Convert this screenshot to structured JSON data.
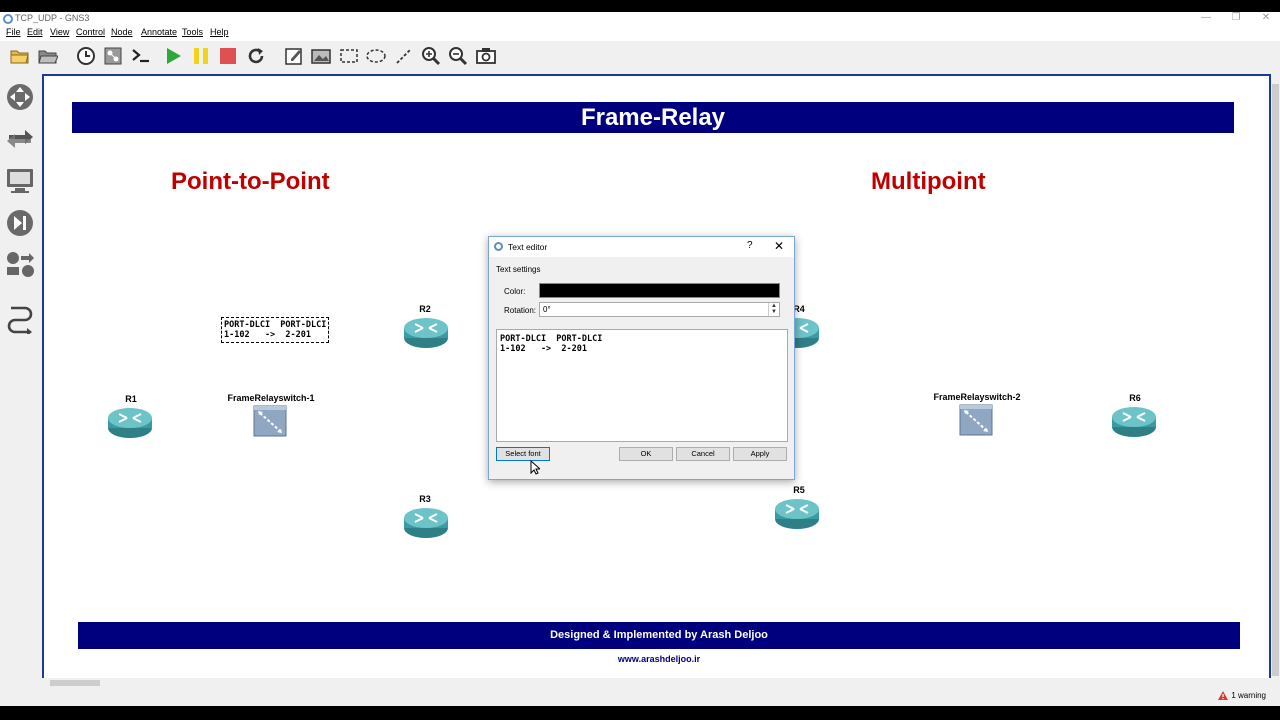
{
  "window": {
    "title": "TCP_UDP - GNS3",
    "controls": {
      "minimize": "—",
      "restore": "❐",
      "close": "✕"
    }
  },
  "menu": [
    "File",
    "Edit",
    "View",
    "Control",
    "Node",
    "Annotate",
    "Tools",
    "Help"
  ],
  "toolbar": [
    "new-project-icon",
    "open-project-icon",
    "snapshot-icon",
    "show-interface-labels-icon",
    "console-all-icon",
    "start-all-icon",
    "suspend-all-icon",
    "stop-all-icon",
    "reload-all-icon",
    "add-note-icon",
    "insert-picture-icon",
    "draw-rectangle-icon",
    "draw-ellipse-icon",
    "draw-line-icon",
    "zoom-in-icon",
    "zoom-out-icon",
    "screenshot-icon"
  ],
  "sidebar": [
    "browse-routers-icon",
    "browse-switches-icon",
    "browse-end-devices-icon",
    "browse-security-devices-icon",
    "browse-all-devices-icon",
    "add-link-icon"
  ],
  "canvas": {
    "banner_title": "Frame-Relay",
    "left_section": "Point-to-Point",
    "right_section": "Multipoint",
    "note_text": "PORT-DLCI  PORT-DLCI\n1-102   ->  2-201",
    "nodes": {
      "r1": "R1",
      "r2": "R2",
      "r3": "R3",
      "r4": "R4",
      "r5": "R5",
      "r6": "R6",
      "sw1": "FrameRelayswitch-1",
      "sw2": "FrameRelayswitch-2"
    },
    "footer_banner": "Designed & Implemented by Arash Deljoo",
    "footer_url": "www.arashdeljoo.ir"
  },
  "dialog": {
    "title": "Text editor",
    "help": "?",
    "close": "✕",
    "section": "Text settings",
    "color_label": "Color:",
    "color_value": "#000000",
    "rotation_label": "Rotation:",
    "rotation_value": "0°",
    "text": "PORT-DLCI  PORT-DLCI\n1-102   ->  2-201",
    "buttons": {
      "select_font": "Select font",
      "ok": "OK",
      "cancel": "Cancel",
      "apply": "Apply"
    }
  },
  "status": {
    "warning": "1 warning"
  },
  "colors": {
    "banner": "#00007f",
    "section_title": "#c00000",
    "canvas_border": "#1a3a94",
    "router": "#3a9ba3"
  }
}
